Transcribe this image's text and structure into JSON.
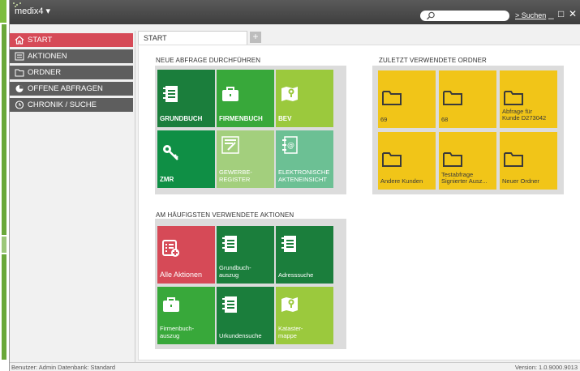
{
  "app": {
    "logo": "medix4 ▾",
    "search_placeholder": "",
    "search_link": "> Suchen",
    "window_controls": {
      "minimize": "_",
      "maximize": "□",
      "close": "✕"
    }
  },
  "sidebar": {
    "items": [
      {
        "label": "START",
        "icon": "home-icon",
        "active": true
      },
      {
        "label": "AKTIONEN",
        "icon": "actions-icon",
        "active": false
      },
      {
        "label": "ORDNER",
        "icon": "folder-icon",
        "active": false
      },
      {
        "label": "OFFENE ABFRAGEN",
        "icon": "pie-icon",
        "active": false
      },
      {
        "label": "CHRONIK / SUCHE",
        "icon": "clock-icon",
        "active": false
      }
    ]
  },
  "tabs": {
    "active": "START",
    "add": "+"
  },
  "new_query": {
    "title": "NEUE ABFRAGE DURCHFÜHREN",
    "tiles": [
      {
        "label": "GRUNDBUCH",
        "icon": "notebook-icon",
        "color": "#1b7e3c"
      },
      {
        "label": "FIRMENBUCH",
        "icon": "briefcase-icon",
        "color": "#38a83a"
      },
      {
        "label": "BEV",
        "icon": "map-pin-icon",
        "color": "#9bc93d"
      },
      {
        "label": "ZMR",
        "icon": "key-icon",
        "color": "#0f8f45"
      },
      {
        "label_line1": "GEWERBE-",
        "label_line2": "REGISTER",
        "icon": "form-icon",
        "color": "#a3cf7d"
      },
      {
        "label_line1": "ELEKTRONISCHE",
        "label_line2": "AKTENEINSICHT",
        "icon": "contacts-icon",
        "color": "#6cc094"
      }
    ]
  },
  "recent_folders": {
    "title": "ZULETZT VERWENDETE ORDNER",
    "folders": [
      {
        "label": "69"
      },
      {
        "label": "68"
      },
      {
        "label_line1": "Abfrage für",
        "label_line2": "Kunde D273042"
      },
      {
        "label": "Andere Kunden"
      },
      {
        "label_line1": "Testabfrage",
        "label_line2": "Signierter Ausz..."
      },
      {
        "label": "Neuer Ordner"
      }
    ]
  },
  "frequent_actions": {
    "title": "AM HÄUFIGSTEN VERWENDETE AKTIONEN",
    "tiles": [
      {
        "label": "Alle Aktionen",
        "icon": "list-add-icon",
        "color": "#d64a57"
      },
      {
        "label_line1": "Grundbuch-",
        "label_line2": "auszug",
        "icon": "notebook-icon",
        "color": "#1b7e3c"
      },
      {
        "label": "Adresssuche",
        "icon": "notebook-icon",
        "color": "#1b7e3c"
      },
      {
        "label_line1": "Firmenbuch-",
        "label_line2": "auszug",
        "icon": "briefcase-icon",
        "color": "#38a83a"
      },
      {
        "label": "Urkundensuche",
        "icon": "notebook-icon",
        "color": "#1b7e3c"
      },
      {
        "label_line1": "Kataster-",
        "label_line2": "mappe",
        "icon": "map-pin-icon",
        "color": "#9bc93d"
      }
    ]
  },
  "status": {
    "left": "Benutzer:  Admin  Datenbank:  Standard",
    "right": "Version:  1.0.9000.9013"
  }
}
